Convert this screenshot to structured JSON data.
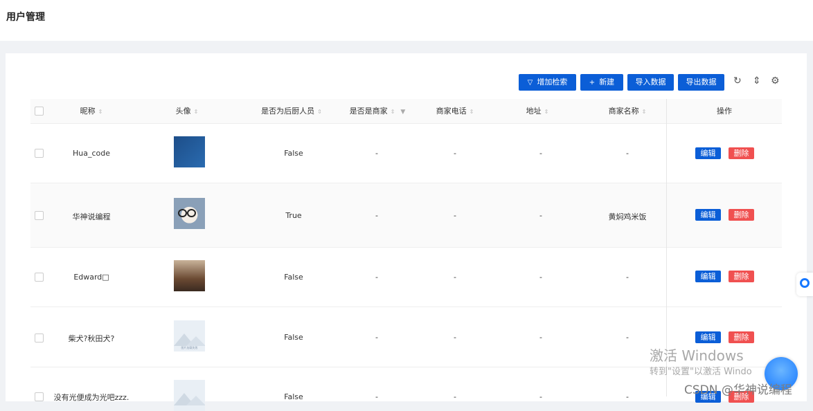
{
  "page": {
    "title": "用户管理"
  },
  "toolbar": {
    "add_filter": "增加检索",
    "new": "新建",
    "import": "导入数据",
    "export": "导出数据"
  },
  "columns": {
    "checkbox": "",
    "nickname": "昵称",
    "avatar": "头像",
    "is_staff": "是否为后厨人员",
    "is_merchant": "是否是商家",
    "merchant_phone": "商家电话",
    "address": "地址",
    "merchant_name": "商家名称",
    "actions": "操作"
  },
  "rows": [
    {
      "nickname": "Hua_code",
      "is_staff": "False",
      "is_merchant": "-",
      "merchant_phone": "-",
      "address": "-",
      "merchant_name": "-"
    },
    {
      "nickname": "华神说编程",
      "is_staff": "True",
      "is_merchant": "-",
      "merchant_phone": "-",
      "address": "-",
      "merchant_name": "黄焖鸡米饭"
    },
    {
      "nickname": "Edward□",
      "is_staff": "False",
      "is_merchant": "-",
      "merchant_phone": "-",
      "address": "-",
      "merchant_name": "-"
    },
    {
      "nickname": "柴犬?秋田犬?",
      "is_staff": "False",
      "is_merchant": "-",
      "merchant_phone": "-",
      "address": "-",
      "merchant_name": "-"
    },
    {
      "nickname": "没有光便成为光吧zzz.",
      "is_staff": "False",
      "is_merchant": "-",
      "merchant_phone": "-",
      "address": "-",
      "merchant_name": "-"
    }
  ],
  "actions": {
    "edit": "编辑",
    "delete": "删除"
  },
  "placeholder_image_text": "图片加载失败",
  "overlay": {
    "activate_title": "激活 Windows",
    "activate_sub": "转到\"设置\"以激活 Windo",
    "csdn": "CSDN @华神说编程"
  },
  "colors": {
    "primary": "#0b5ed7",
    "danger": "#f05050"
  }
}
